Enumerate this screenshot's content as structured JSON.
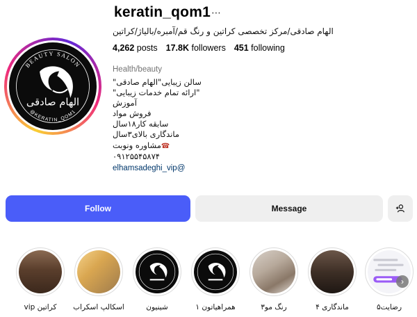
{
  "profile": {
    "username": "keratin_qom1",
    "more_icon": "more-horizontal-icon",
    "full_name": "الهام صادقی/مرکز تخصصی کراتین و رنگ قم/آمبره/بالیاژ/کراتین",
    "avatar": {
      "top_text": "BEAUTY SALON",
      "bottom_text": "@KERATIN_QOM1",
      "brand_text": "الهام صادقی"
    }
  },
  "stats": {
    "posts_count": "4,262",
    "posts_label": "posts",
    "followers_count": "17.8K",
    "followers_label": "followers",
    "following_count": "451",
    "following_label": "following"
  },
  "bio": {
    "category": "Health/beauty",
    "lines": [
      "سالن زیبایی\"الهام صادقی\"",
      "\"ارائه تمام خدمات زیبایی\"",
      "آموزش",
      "فروش مواد",
      "سابقه کار۱۸سال",
      "ماندگاری بالای۳سال",
      "مشاوره ونوبت",
      "۰۹۱۲۵۵۴۵۸۷۴"
    ],
    "phone_icon": "telephone-icon",
    "link": "elhamsadeghi_vip@"
  },
  "actions": {
    "follow_label": "Follow",
    "message_label": "Message",
    "suggest_icon": "add-person-icon"
  },
  "highlights": [
    {
      "label": "کراتین vip"
    },
    {
      "label": "اسکالپ اسکراب"
    },
    {
      "label": "شینیون"
    },
    {
      "label": "همراهیاتون ۱"
    },
    {
      "label": "رنگ مو۳"
    },
    {
      "label": "ماندگاری ۴"
    },
    {
      "label": "رضایت۵"
    }
  ],
  "colors": {
    "follow_button": "#4a5df9",
    "secondary_button": "#efefef",
    "link": "#00376b",
    "muted_text": "#737373"
  }
}
